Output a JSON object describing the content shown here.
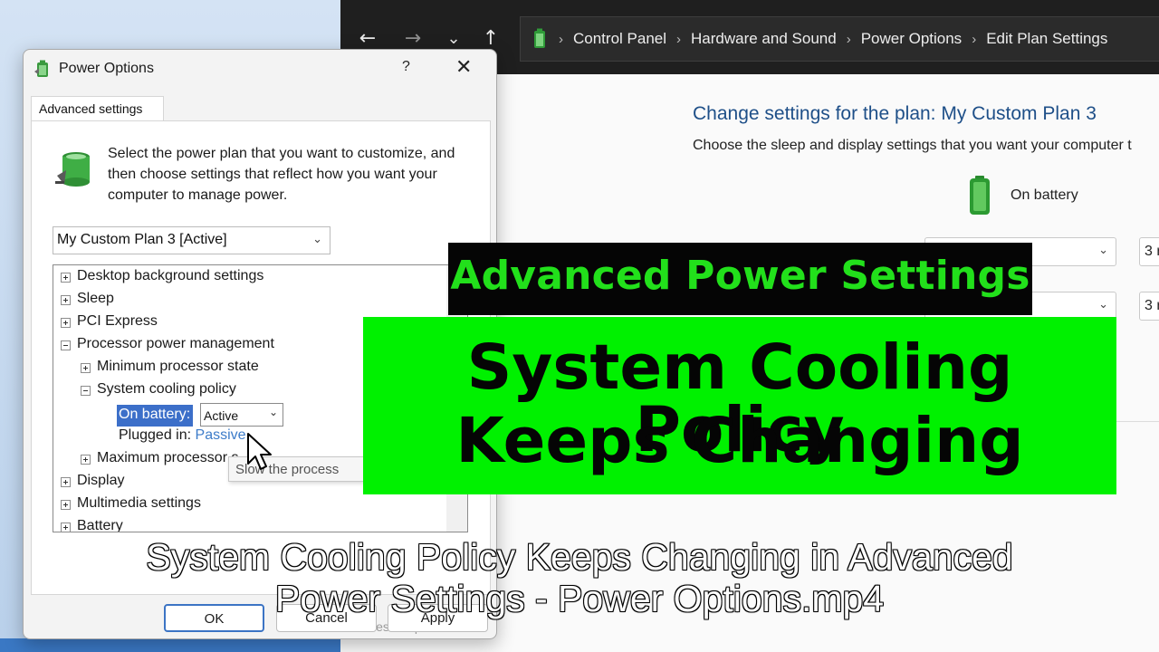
{
  "control_panel": {
    "nav": {
      "back": "←",
      "forward": "→",
      "recent": "⌄",
      "up": "↑"
    },
    "breadcrumb": [
      "Control Panel",
      "Hardware and Sound",
      "Power Options",
      "Edit Plan Settings"
    ],
    "title": "Change settings for the plan: My Custom Plan 3",
    "subtitle": "Choose the sleep and display settings that you want your computer t",
    "on_battery_label": "On battery",
    "partial_values": [
      "3 r",
      "3 r"
    ]
  },
  "dialog": {
    "title": "Power Options",
    "help": "?",
    "close": "✕",
    "tab": "Advanced settings",
    "description": "Select the power plan that you want to customize, and then choose settings that reflect how you want your computer to manage power.",
    "plan_select": "My Custom Plan 3 [Active]",
    "tree": [
      "Desktop background settings",
      "Sleep",
      "PCI Express",
      "Processor power management",
      "Minimum processor state",
      "System cooling policy",
      "Maximum processor s",
      "Display",
      "Multimedia settings",
      "Battery"
    ],
    "on_battery_label": "On battery:",
    "on_battery_value": "Active",
    "plugged_in_label": "Plugged in:",
    "plugged_in_value": "Passive",
    "tooltip": "Slow the process",
    "restore_partial": "Restore plan defaults",
    "buttons": {
      "ok": "OK",
      "cancel": "Cancel",
      "apply": "Apply"
    }
  },
  "overlay": {
    "banner_small": "Advanced Power Settings",
    "banner_big_line1": "System Cooling Policy",
    "banner_big_line2": "Keeps Changing",
    "caption_line1": "System Cooling Policy Keeps Changing in Advanced",
    "caption_line2": "Power Settings - Power Options.mp4"
  },
  "colors": {
    "banner_green": "#00f100",
    "banner_text_green": "#22e01b",
    "selection_blue": "#3c6fc9",
    "link_blue": "#3d7cc9",
    "title_blue": "#1e4f88"
  },
  "icons": [
    "battery-plug-icon",
    "battery-icon",
    "chevron-down-icon",
    "close-icon",
    "help-icon",
    "expand-icon",
    "collapse-icon",
    "mouse-cursor-icon"
  ]
}
